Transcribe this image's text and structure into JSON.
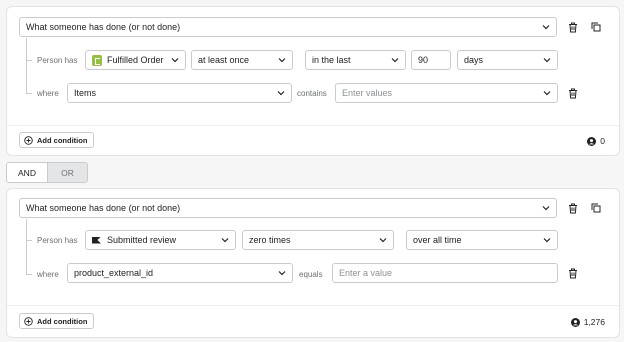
{
  "blocks": [
    {
      "type_label": "What someone has done (or not done)",
      "person_has_label": "Person has",
      "metric_label": "Fulfilled Order",
      "metric_icon": "shopify-icon",
      "frequency_label": "at least once",
      "timeframe_label": "in the last",
      "timeframe_value": "90",
      "timeframe_unit": "days",
      "where_label": "where",
      "property_label": "Items",
      "operator_label": "contains",
      "value_placeholder": "Enter values",
      "add_condition_label": "Add condition",
      "count": "0"
    },
    {
      "type_label": "What someone has done (or not done)",
      "person_has_label": "Person has",
      "metric_label": "Submitted review",
      "metric_icon": "review-flag-icon",
      "frequency_label": "zero times",
      "timeframe_label": "over all time",
      "where_label": "where",
      "property_label": "product_external_id",
      "operator_label": "equals",
      "value_placeholder": "Enter a value",
      "add_condition_label": "Add condition",
      "count": "1,276"
    }
  ],
  "toggle": {
    "and_label": "AND",
    "or_label": "OR",
    "selected": "AND"
  },
  "colors": {
    "background": "#f6f6f7",
    "border": "#c9cccf",
    "shopify_green": "#95bf47"
  }
}
